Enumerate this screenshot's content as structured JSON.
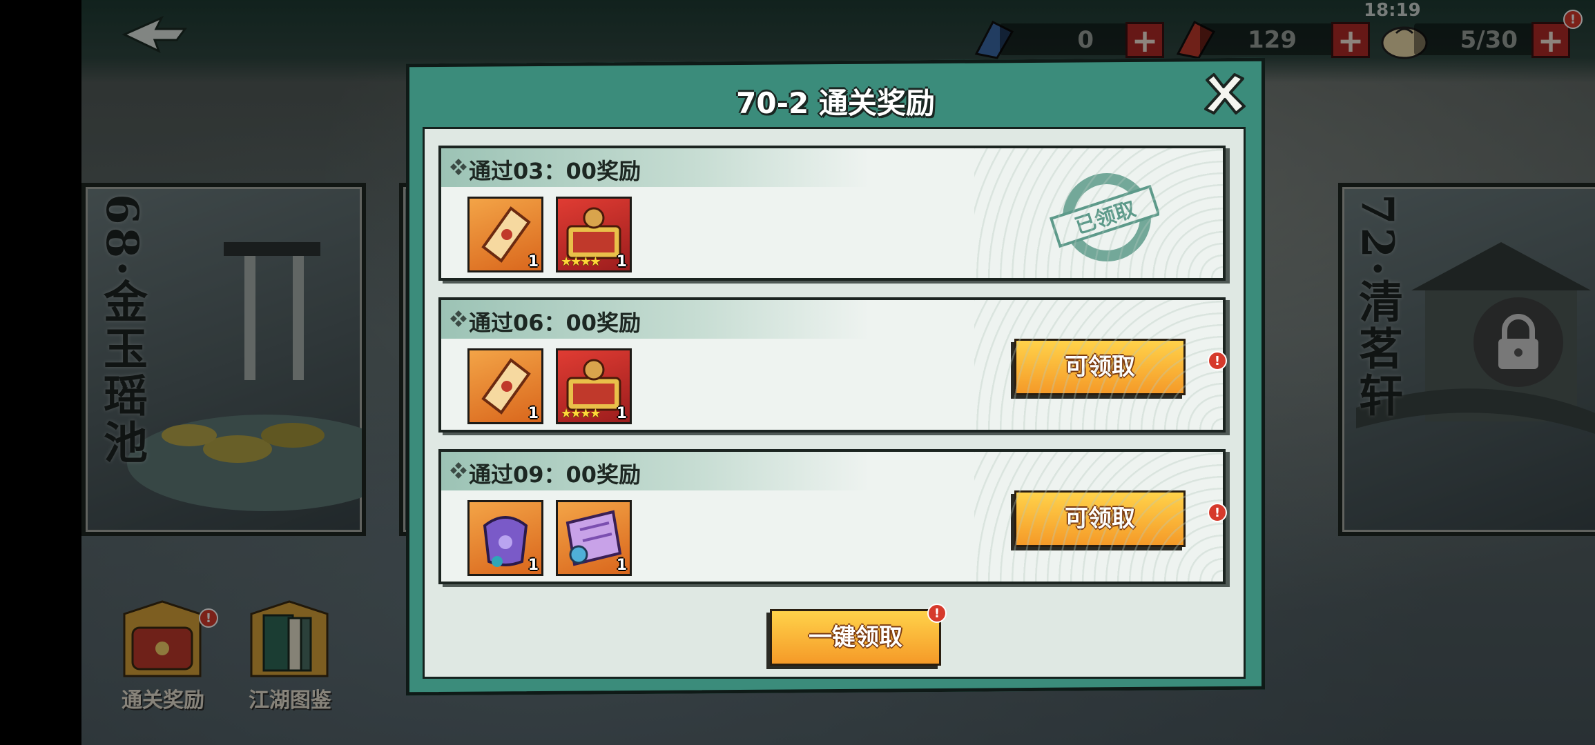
{
  "status_bar": {
    "time": "18:19"
  },
  "resources": [
    {
      "name": "blue-ticket",
      "value": "0"
    },
    {
      "name": "red-ticket",
      "value": "129"
    },
    {
      "name": "bun-stamina",
      "value": "5/30"
    }
  ],
  "background": {
    "cards": [
      {
        "title": "68·金玉瑶池"
      },
      {
        "title": "72·清茗轩"
      }
    ],
    "bottom_buttons": [
      {
        "label": "通关奖励"
      },
      {
        "label": "江湖图鉴"
      }
    ]
  },
  "dialog": {
    "title": "70-2 通关奖励",
    "rows": [
      {
        "title": "通过03：00奖励",
        "items": [
          {
            "icon": "orange-talisman-icon",
            "count": "1",
            "stars": ""
          },
          {
            "icon": "red-treasure-chest-icon",
            "count": "1",
            "stars": "★★★★"
          }
        ],
        "status": "已领取"
      },
      {
        "title": "通过06：00奖励",
        "items": [
          {
            "icon": "orange-talisman-icon",
            "count": "1",
            "stars": ""
          },
          {
            "icon": "red-treasure-chest-icon",
            "count": "1",
            "stars": "★★★★"
          }
        ],
        "button": "可领取"
      },
      {
        "title": "通过09：00奖励",
        "items": [
          {
            "icon": "purple-pouch-icon",
            "count": "1",
            "stars": ""
          },
          {
            "icon": "purple-scroll-icon",
            "count": "1",
            "stars": ""
          }
        ],
        "button": "可领取"
      }
    ],
    "claim_all": "一键领取"
  },
  "colors": {
    "dialog_frame": "#3b8c7b",
    "claim_button": "#f8b636",
    "badge_red": "#d63a2c"
  }
}
